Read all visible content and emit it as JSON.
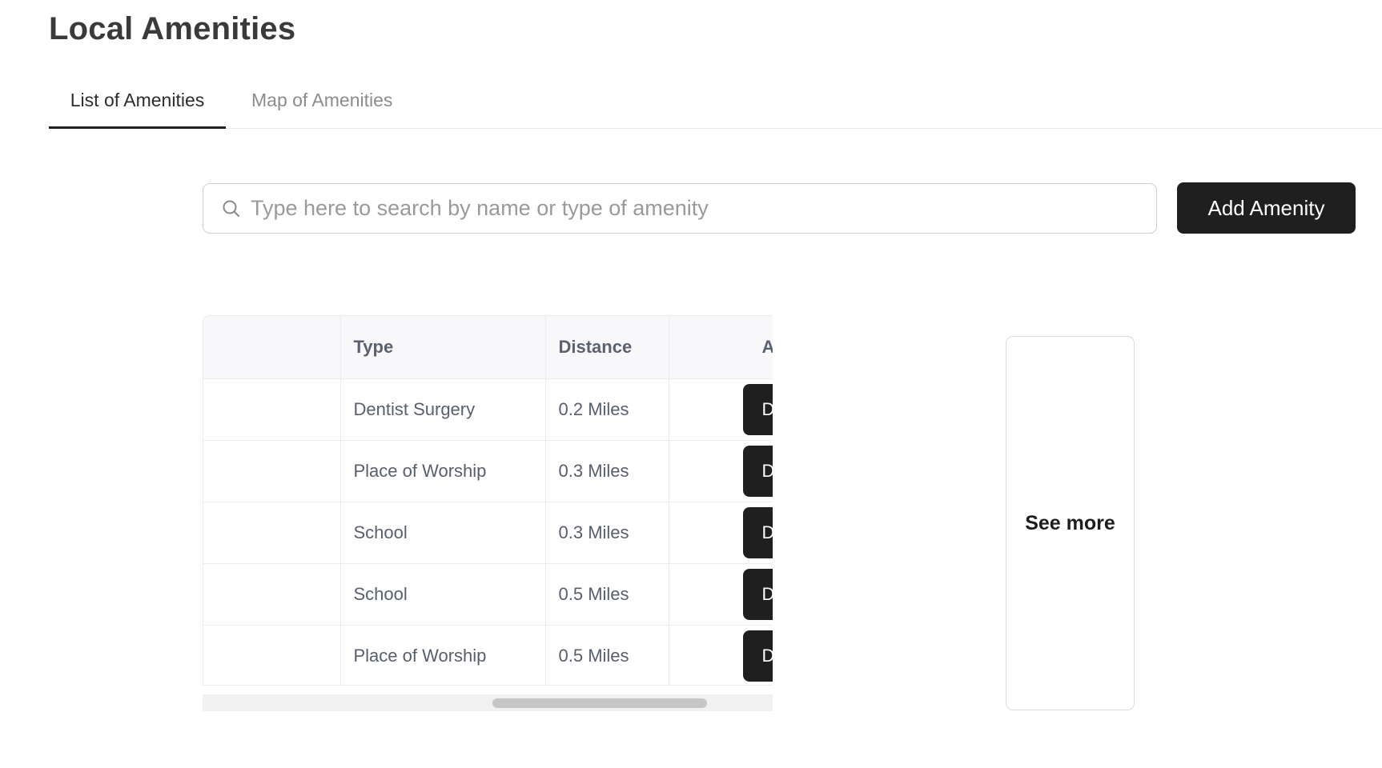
{
  "page": {
    "title": "Local Amenities"
  },
  "tabs": [
    {
      "label": "List of Amenities",
      "active": true
    },
    {
      "label": "Map of Amenities",
      "active": false
    }
  ],
  "search": {
    "placeholder": "Type here to search by name or type of amenity",
    "value": "",
    "icon": "search-icon"
  },
  "toolbar": {
    "add_label": "Add Amenity"
  },
  "table": {
    "columns": [
      "",
      "Type",
      "Distance",
      "A"
    ],
    "rows": [
      {
        "name": "",
        "type": "Dentist Surgery",
        "distance": "0.2 Miles",
        "action": "D"
      },
      {
        "name": "",
        "type": "Place of Worship",
        "distance": "0.3 Miles",
        "action": "D"
      },
      {
        "name": "",
        "type": "School",
        "distance": "0.3 Miles",
        "action": "D"
      },
      {
        "name": "",
        "type": "School",
        "distance": "0.5 Miles",
        "action": "D"
      },
      {
        "name": "",
        "type": "Place of Worship",
        "distance": "0.5 Miles",
        "action": "D"
      }
    ]
  },
  "see_more": {
    "label": "See more"
  },
  "colors": {
    "primary_button": "#1f1f1f",
    "header_bg": "#f8f8fa",
    "muted_text": "#8c8c8c"
  }
}
